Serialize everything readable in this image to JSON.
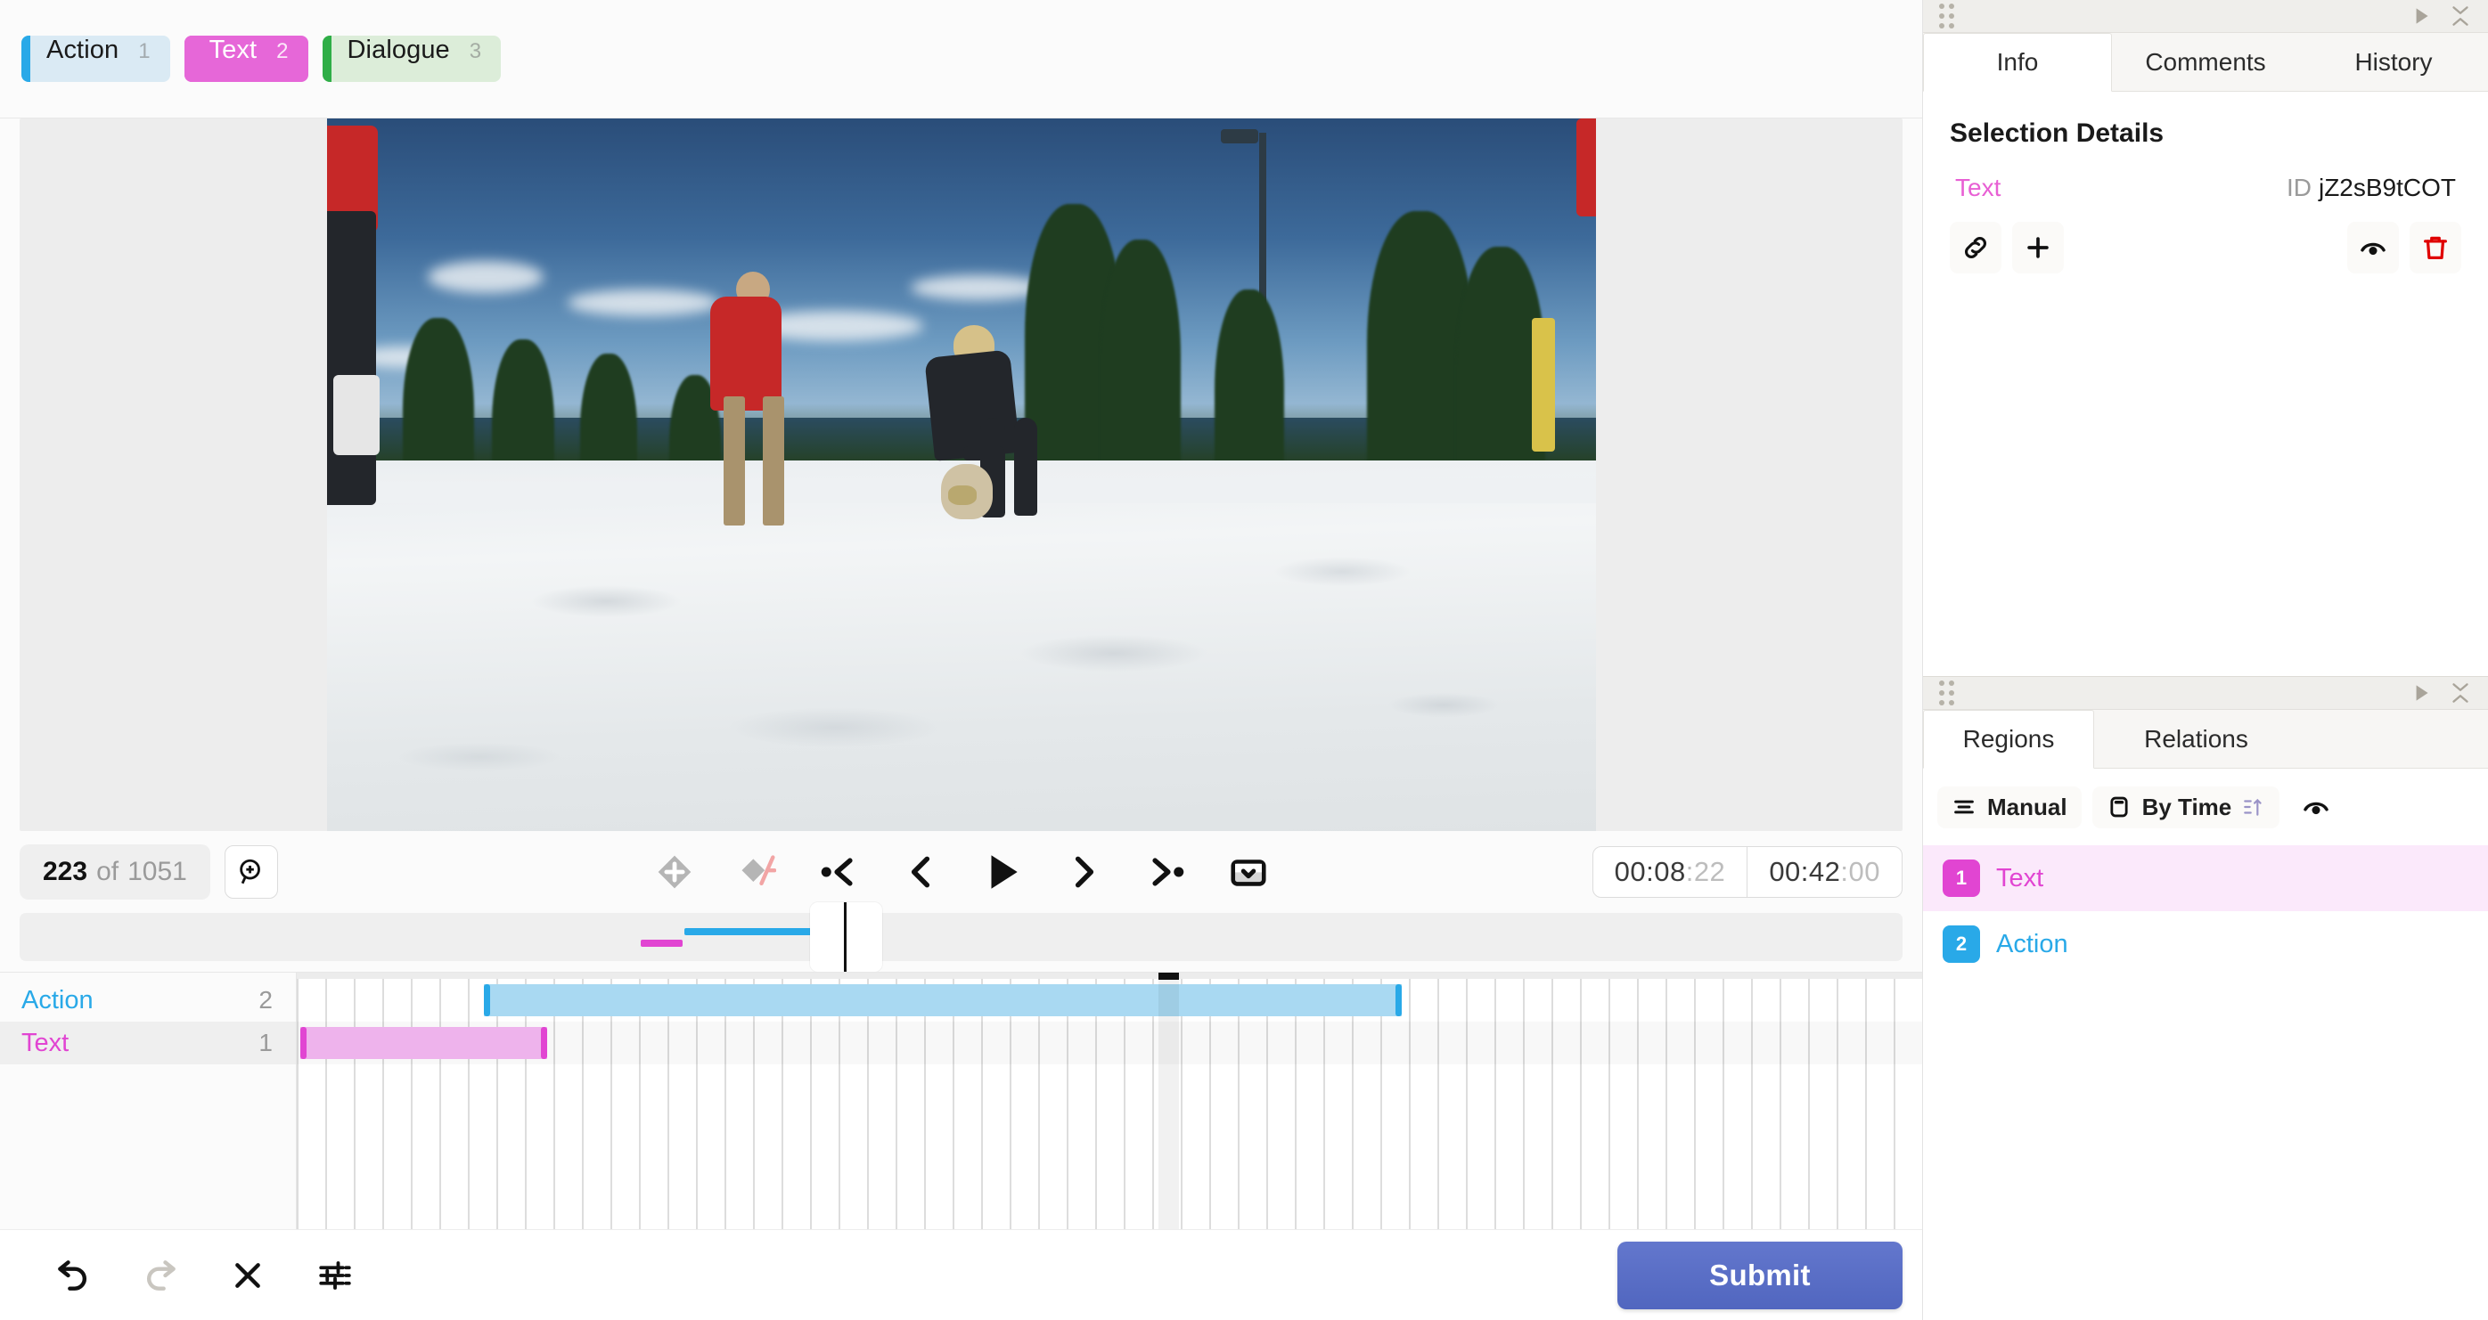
{
  "labels": {
    "items": [
      {
        "name": "Action",
        "hotkey": "1",
        "color": "#29a9e8",
        "bg": "#daeaf4",
        "style": "chip-action"
      },
      {
        "name": "Text",
        "hotkey": "2",
        "color": "#e667d8",
        "bg": "#e667d8",
        "style": "chip-text"
      },
      {
        "name": "Dialogue",
        "hotkey": "3",
        "color": "#2fae47",
        "bg": "#dcedd9",
        "style": "chip-dialogue"
      }
    ]
  },
  "transport": {
    "frame_current": "223",
    "frame_of": "of",
    "frame_total": "1051",
    "zoom_icon": "zoom-in-icon",
    "buttons": [
      {
        "name": "add-keyframe-button",
        "icon": "diamond-plus-icon"
      },
      {
        "name": "remove-keyframe-button",
        "icon": "diamond-minus-icon"
      },
      {
        "name": "prev-keyframe-button",
        "icon": "skip-back-icon"
      },
      {
        "name": "prev-frame-button",
        "icon": "chevron-left-icon"
      },
      {
        "name": "play-button",
        "icon": "play-icon"
      },
      {
        "name": "next-frame-button",
        "icon": "chevron-right-icon"
      },
      {
        "name": "next-keyframe-button",
        "icon": "skip-forward-icon"
      },
      {
        "name": "playback-options-button",
        "icon": "chevron-down-box-icon"
      }
    ],
    "time_current_main": "00:08",
    "time_current_frac": ":22",
    "time_total_main": "00:42",
    "time_total_frac": ":00"
  },
  "timeline": {
    "tracks": [
      {
        "label": "Action",
        "count": "2",
        "color": "#29a9e8",
        "fill": "#a9d9f2",
        "selected": false,
        "start_pct": 11.5,
        "width_pct": 56.5
      },
      {
        "label": "Text",
        "count": "1",
        "color": "#e145d2",
        "fill": "#eeb3ec",
        "selected": true,
        "start_pct": 0.2,
        "width_pct": 15.2
      }
    ],
    "playhead_pct": 53.0
  },
  "bottom": {
    "buttons": [
      {
        "name": "undo-button",
        "icon": "undo-icon",
        "disabled": false
      },
      {
        "name": "redo-button",
        "icon": "redo-icon",
        "disabled": true
      },
      {
        "name": "clear-button",
        "icon": "close-icon",
        "disabled": false
      },
      {
        "name": "settings-button",
        "icon": "sliders-icon",
        "disabled": false
      }
    ],
    "submit_label": "Submit"
  },
  "info_panel": {
    "tabs": [
      {
        "label": "Info",
        "active": true
      },
      {
        "label": "Comments",
        "active": false
      },
      {
        "label": "History",
        "active": false
      }
    ],
    "section_title": "Selection Details",
    "selection_label": "Text",
    "selection_label_color": "#e85fd4",
    "id_key": "ID",
    "id_value": "jZ2sB9tCOT",
    "actions": [
      {
        "name": "relation-link-button",
        "icon": "link-icon",
        "color": "#111111"
      },
      {
        "name": "add-region-button",
        "icon": "plus-icon",
        "color": "#111111"
      },
      {
        "name": "hide-region-button",
        "icon": "eye-icon",
        "color": "#111111"
      },
      {
        "name": "delete-region-button",
        "icon": "trash-icon",
        "color": "#e00000"
      }
    ]
  },
  "regions_panel": {
    "tabs": [
      {
        "label": "Regions",
        "active": true
      },
      {
        "label": "Relations",
        "active": false
      }
    ],
    "toolbar": {
      "order_label": "Manual",
      "group_label": "By Time",
      "order_icon": "sort-lines-icon",
      "group_icon": "card-icon",
      "sort-direction_icon": "sort-asc-icon",
      "visibility_icon": "eye-icon"
    },
    "items": [
      {
        "index": "1",
        "label": "Text",
        "color": "#e145d2",
        "selected": true
      },
      {
        "index": "2",
        "label": "Action",
        "color": "#29a9e8",
        "selected": false
      }
    ]
  },
  "panel_header": {
    "drag_icon": "drag-handle-icon",
    "expand_icon": "play-triangle-icon",
    "collapse_icon": "collapse-chevrons-icon"
  }
}
